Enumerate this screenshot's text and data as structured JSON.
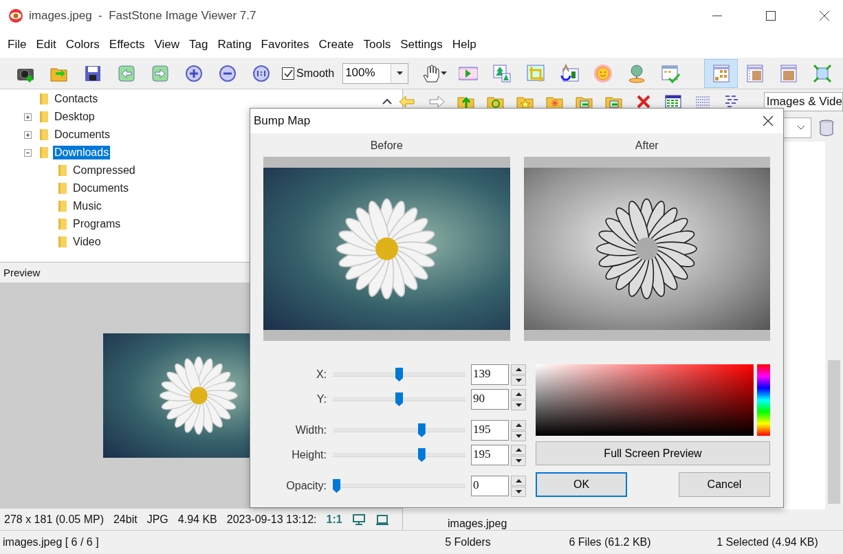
{
  "window": {
    "title": "images.jpeg  -  FastStone Image Viewer 7.7"
  },
  "menu": [
    "File",
    "Edit",
    "Colors",
    "Effects",
    "View",
    "Tag",
    "Rating",
    "Favorites",
    "Create",
    "Tools",
    "Settings",
    "Help"
  ],
  "toolbar": {
    "smooth": {
      "label": "Smooth",
      "checked": true
    },
    "zoom": "100%",
    "layout_buttons": [
      {
        "kind": "thumbnails",
        "selected": true
      },
      {
        "kind": "thumbs-preview",
        "selected": false
      },
      {
        "kind": "preview",
        "selected": false
      }
    ]
  },
  "tree": [
    {
      "label": "Contacts",
      "selected": false
    },
    {
      "label": "Desktop",
      "selected": false,
      "expanded": false
    },
    {
      "label": "Documents",
      "selected": false,
      "expanded": false
    },
    {
      "label": "Downloads",
      "selected": true,
      "expanded": true,
      "children": [
        {
          "label": "Compressed",
          "selected": false
        },
        {
          "label": "Documents",
          "selected": false
        },
        {
          "label": "Music",
          "selected": false
        },
        {
          "label": "Programs",
          "selected": false
        },
        {
          "label": "Video",
          "selected": false
        }
      ]
    }
  ],
  "preview": {
    "title": "Preview",
    "info": [
      "278 x 181 (0.05 MP)",
      "24bit",
      "JPG",
      "4.94 KB",
      "2023-09-13 13:12:"
    ],
    "ratio": "1:1"
  },
  "browser": {
    "filter": "Images & Vide",
    "file_label": "images.jpeg"
  },
  "dialog": {
    "title": "Bump Map",
    "before_label": "Before",
    "after_label": "After",
    "sliders": [
      {
        "label": "X:",
        "level": 0.5,
        "value": "139"
      },
      {
        "label": "Y:",
        "level": 0.5,
        "value": "90"
      },
      {
        "label": "Width:",
        "level": 0.68,
        "value": "195"
      },
      {
        "label": "Height:",
        "level": 0.68,
        "value": "195"
      },
      {
        "label": "Opacity:",
        "level": 0,
        "value": "0"
      }
    ],
    "buttons": {
      "preview": "Full Screen Preview",
      "ok": "OK",
      "cancel": "Cancel"
    }
  },
  "status_bar": [
    "images.jpeg [ 6 / 6 ]",
    "5 Folders",
    "6 Files (61.2 KB)",
    "1 Selected (4.94 KB)"
  ]
}
